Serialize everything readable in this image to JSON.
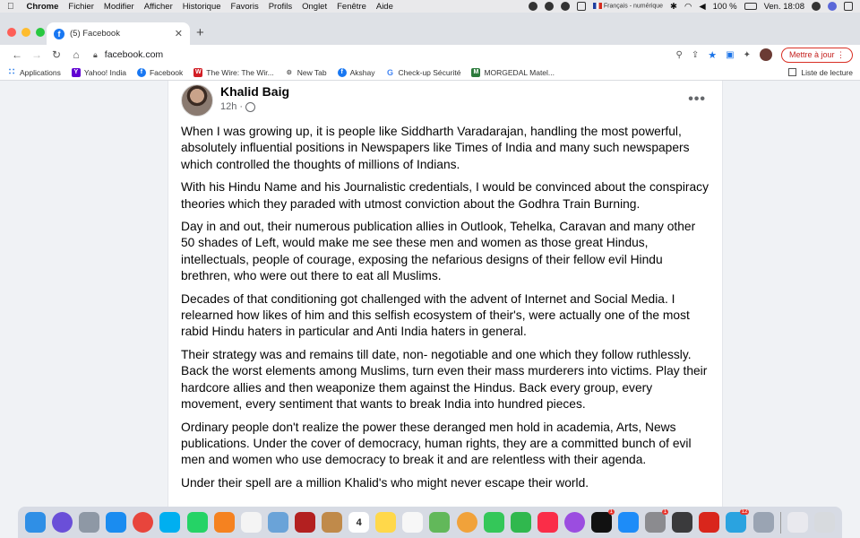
{
  "menubar": {
    "app_name": "Chrome",
    "items": [
      "Fichier",
      "Modifier",
      "Afficher",
      "Historique",
      "Favoris",
      "Profils",
      "Onglet",
      "Fenêtre",
      "Aide"
    ],
    "input_source": "Français - numérique",
    "battery": "100 %",
    "clock": "Ven. 18:08"
  },
  "browser": {
    "tab_title": "(5) Facebook",
    "url": "facebook.com",
    "update_button": "Mettre à jour",
    "reading_list": "Liste de lecture",
    "bookmarks": [
      {
        "label": "Applications",
        "icon": "apps-grid-icon"
      },
      {
        "label": "Yahoo! India",
        "icon": "yahoo-icon"
      },
      {
        "label": "Facebook",
        "icon": "facebook-icon"
      },
      {
        "label": "The Wire: The Wir...",
        "icon": "the-wire-icon"
      },
      {
        "label": "New Tab",
        "icon": "new-tab-icon"
      },
      {
        "label": "Akshay",
        "icon": "facebook-icon"
      },
      {
        "label": "Check-up Sécurité",
        "icon": "google-icon"
      },
      {
        "label": "MORGEDAL Matel...",
        "icon": "morgedal-icon"
      }
    ]
  },
  "post": {
    "author": "Khalid Baig",
    "time": "12h",
    "paragraphs": [
      "When I was growing up, it is people like Siddharth Varadarajan, handling the most powerful, absolutely influential positions in Newspapers like Times of India and many such newspapers which controlled the thoughts of millions of Indians.",
      "With his Hindu Name and his Journalistic credentials, I would be convinced about the conspiracy theories which they paraded with utmost conviction about the Godhra Train Burning.",
      "Day in and out, their numerous publication allies in Outlook, Tehelka, Caravan and many other 50 shades of Left, would make me see these men and women as those great Hindus, intellectuals, people of courage, exposing the nefarious designs of their fellow evil Hindu brethren, who were out there to eat all Muslims.",
      "Decades of that conditioning got challenged with the advent of Internet and Social Media. I relearned how likes of him and this selfish ecosystem of their's, were actually one of the most rabid Hindu haters in particular and Anti India haters in general.",
      "Their strategy was and remains till date, non- negotiable and one which they follow ruthlessly. Back the worst elements among Muslims, turn even their mass murderers into victims. Play their hardcore allies and then weaponize them against the Hindus. Back every group, every movement, every sentiment that wants to break India into hundred pieces.",
      "Ordinary people don't realize the power these deranged men hold in academia, Arts, News publications. Under the cover of democracy, human rights, they are a committed bunch of evil men and women who use democracy to break it and are relentless with their agenda.",
      "Under their spell are a million Khalid's who might never escape their world."
    ]
  },
  "dock": {
    "apps": [
      {
        "name": "finder-icon",
        "color": "#2f8fe6"
      },
      {
        "name": "siri-icon",
        "color": "#6a4fd8"
      },
      {
        "name": "launchpad-icon",
        "color": "#8e98a5"
      },
      {
        "name": "safari-icon",
        "color": "#1a8cf0"
      },
      {
        "name": "chrome-icon",
        "color": "#e8453c"
      },
      {
        "name": "skype-icon",
        "color": "#00aff0"
      },
      {
        "name": "whatsapp-icon",
        "color": "#25d366"
      },
      {
        "name": "vlc-icon",
        "color": "#f58220"
      },
      {
        "name": "textedit-icon",
        "color": "#f4f4f4"
      },
      {
        "name": "preview-icon",
        "color": "#6aa3d8"
      },
      {
        "name": "photo-booth-icon",
        "color": "#b32020"
      },
      {
        "name": "contacts-icon",
        "color": "#c08a4a"
      },
      {
        "name": "calendar-icon",
        "color": "#ffffff",
        "label": "4"
      },
      {
        "name": "notes-icon",
        "color": "#ffd84a"
      },
      {
        "name": "reminders-icon",
        "color": "#f7f7f7"
      },
      {
        "name": "maps-icon",
        "color": "#62b85a"
      },
      {
        "name": "photos-icon",
        "color": "#f1a23a"
      },
      {
        "name": "messages-icon",
        "color": "#34c759"
      },
      {
        "name": "facetime-icon",
        "color": "#30b84e"
      },
      {
        "name": "music-icon",
        "color": "#fa2d48"
      },
      {
        "name": "podcasts-icon",
        "color": "#9b4de0"
      },
      {
        "name": "apple-tv-icon",
        "color": "#111111",
        "badge": "1"
      },
      {
        "name": "app-store-icon",
        "color": "#1d8cf8"
      },
      {
        "name": "system-preferences-icon",
        "color": "#8b8b8f",
        "badge": "1"
      },
      {
        "name": "quicktime-icon",
        "color": "#3a3a3c"
      },
      {
        "name": "acrobat-icon",
        "color": "#d9261c"
      },
      {
        "name": "telegram-icon",
        "color": "#2aa3e0",
        "badge": "12"
      },
      {
        "name": "scanner-icon",
        "color": "#9aa4b3"
      }
    ],
    "trailing": [
      {
        "name": "downloads-stack-icon",
        "color": "#e9e9ee"
      },
      {
        "name": "trash-icon",
        "color": "#d7dade"
      }
    ]
  }
}
